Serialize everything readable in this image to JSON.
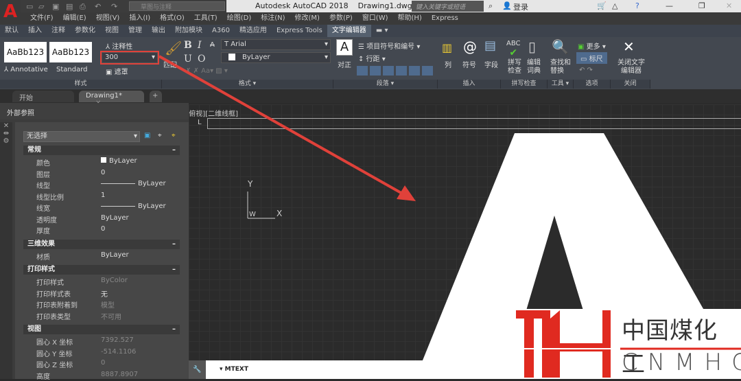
{
  "titlebar": {
    "app": "Autodesk AutoCAD 2018",
    "file": "Drawing1.dwg",
    "workspace": "草图与注释",
    "search_placeholder": "键入关键字或短语",
    "login": "登录",
    "minimize": "—",
    "restore": "❐",
    "close": "✕"
  },
  "menu": [
    "文件(F)",
    "编辑(E)",
    "视图(V)",
    "插入(I)",
    "格式(O)",
    "工具(T)",
    "绘图(D)",
    "标注(N)",
    "修改(M)",
    "参数(P)",
    "窗口(W)",
    "帮助(H)",
    "Express"
  ],
  "ribbon_tabs": [
    "默认",
    "插入",
    "注释",
    "参数化",
    "视图",
    "管理",
    "输出",
    "附加模块",
    "A360",
    "精选应用",
    "Express Tools",
    "文字编辑器"
  ],
  "ribbon": {
    "style": {
      "swatch1": "AaBb123",
      "swatch1_name": "Annotative",
      "swatch2": "AaBb123",
      "swatch2_name": "Standard",
      "annotative": "注释性",
      "height": "300",
      "mask": "遮罩",
      "label": "样式"
    },
    "format": {
      "match": "匹配",
      "bold": "B",
      "italic": "I",
      "strike": "A",
      "underline": "U",
      "overline": "O",
      "font": "Arial",
      "color": "ByLayer",
      "label": "格式 ▾"
    },
    "paragraph": {
      "justify": "对正",
      "bullets": "项目符号和编号 ▾",
      "linespacing": "行距 ▾",
      "label": "段落 ▾"
    },
    "insert": {
      "columns": "列",
      "symbol": "符号",
      "field": "字段",
      "label": "插入"
    },
    "spell": {
      "check": "拼写检查",
      "dict": "编辑词典",
      "label": "拼写检查"
    },
    "tools": {
      "find": "查找和替换",
      "label": "工具 ▾"
    },
    "options": {
      "more": "更多 ▾",
      "ruler": "标尺",
      "label": "选项"
    },
    "close": {
      "btn": "关闭文字编辑器",
      "label": "关闭"
    }
  },
  "filetabs": {
    "start": "开始",
    "drawing": "Drawing1*"
  },
  "palette": {
    "title": "外部参照",
    "selection": "无选择",
    "sections": [
      {
        "name": "常规",
        "rows": [
          [
            "颜色",
            "ByLayer"
          ],
          [
            "图层",
            "0"
          ],
          [
            "线型",
            "ByLayer"
          ],
          [
            "线型比例",
            "1"
          ],
          [
            "线宽",
            "ByLayer"
          ],
          [
            "透明度",
            "ByLayer"
          ],
          [
            "厚度",
            "0"
          ]
        ]
      },
      {
        "name": "三维效果",
        "rows": [
          [
            "材质",
            "ByLayer"
          ]
        ]
      },
      {
        "name": "打印样式",
        "rows": [
          [
            "打印样式",
            "ByColor"
          ],
          [
            "打印样式表",
            "无"
          ],
          [
            "打印表附着到",
            "模型"
          ],
          [
            "打印表类型",
            "不可用"
          ]
        ]
      },
      {
        "name": "视图",
        "rows": [
          [
            "圆心 X 坐标",
            "7392.527"
          ],
          [
            "圆心 Y 坐标",
            "-514.1106"
          ],
          [
            "圆心 Z 坐标",
            "0"
          ],
          [
            "高度",
            "8887.8907"
          ]
        ]
      }
    ]
  },
  "viewport": {
    "label": "[-][俯视][二维线框]",
    "ucs_y": "Y",
    "ucs_x": "X",
    "ucs_w": "W"
  },
  "command": {
    "text": "MTEXT"
  },
  "logo": {
    "cn": "中国煤化工",
    "en": "CNMHG"
  },
  "colors": {
    "accent": "#e0413a",
    "logo_red": "#e02a20"
  }
}
